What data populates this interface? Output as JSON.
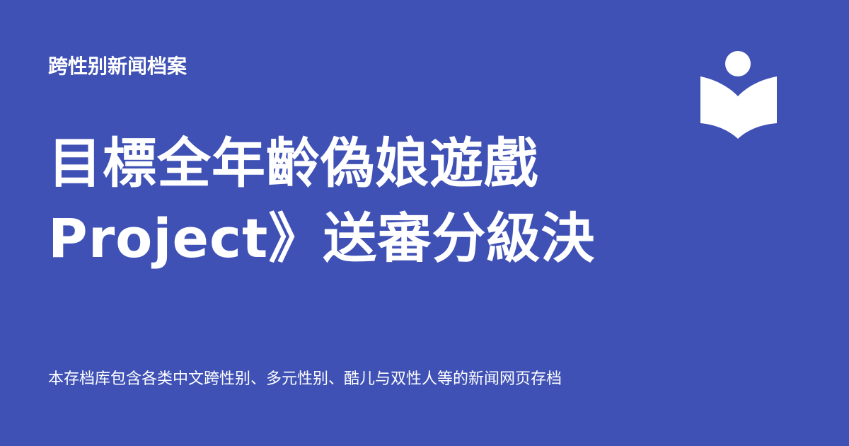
{
  "site": {
    "name": "跨性别新闻档案",
    "description": "本存档库包含各类中文跨性别、多元性别、酷儿与双性人等的新闻网页存档"
  },
  "article": {
    "title_line1": "目標全年齡偽娘遊戲",
    "title_line2": "Project》送審分級決"
  },
  "colors": {
    "background": "#3f51b5",
    "text": "#ffffff"
  },
  "icons": {
    "logo": "book-reader-icon"
  }
}
